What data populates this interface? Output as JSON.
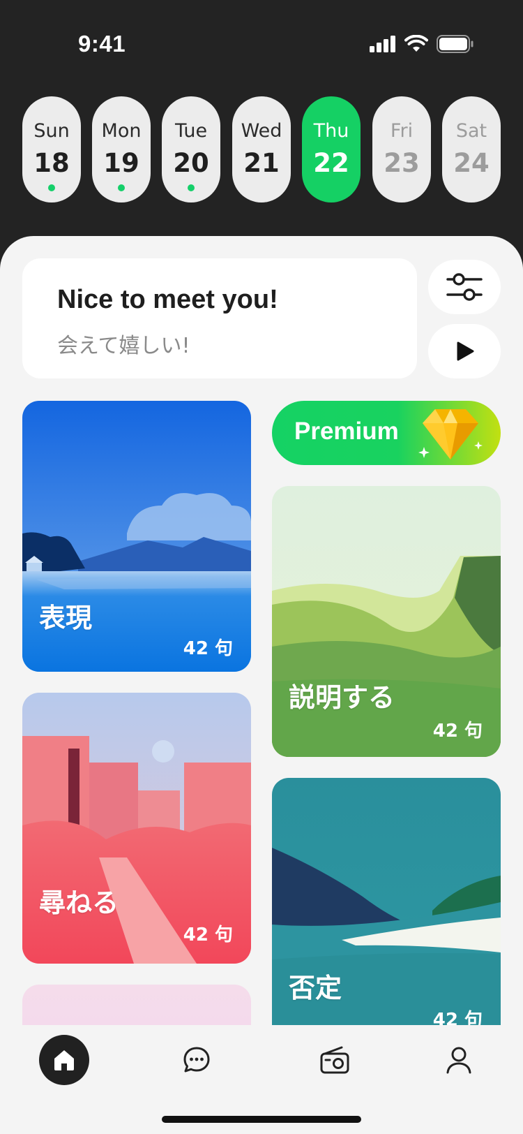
{
  "status_bar": {
    "time": "9:41",
    "icons": [
      "cellular-signal-icon",
      "wifi-icon",
      "battery-icon"
    ]
  },
  "days": [
    {
      "name": "Sun",
      "num": "18",
      "state": "done"
    },
    {
      "name": "Mon",
      "num": "19",
      "state": "done"
    },
    {
      "name": "Tue",
      "num": "20",
      "state": "done"
    },
    {
      "name": "Wed",
      "num": "21",
      "state": "past"
    },
    {
      "name": "Thu",
      "num": "22",
      "state": "active"
    },
    {
      "name": "Fri",
      "num": "23",
      "state": "future"
    },
    {
      "name": "Sat",
      "num": "24",
      "state": "future"
    }
  ],
  "phrase": {
    "english": "Nice to meet you!",
    "japanese": "会えて嬉しい!"
  },
  "controls": {
    "settings_icon": "sliders-icon",
    "play_icon": "play-icon"
  },
  "premium": {
    "label": "Premium",
    "icon": "diamond-icon"
  },
  "cards": [
    {
      "title": "表現",
      "count": "42 句"
    },
    {
      "title": "説明する",
      "count": "42 句"
    },
    {
      "title": "尋ねる",
      "count": "42 句"
    },
    {
      "title": "否定",
      "count": "42 句"
    }
  ],
  "tabbar": {
    "items": [
      "home-icon",
      "chat-icon",
      "radio-icon",
      "profile-icon"
    ]
  },
  "colors": {
    "accent": "#15d064",
    "background_dark": "#232323",
    "sheet": "#f4f4f4",
    "dot": "#15cf6a"
  }
}
